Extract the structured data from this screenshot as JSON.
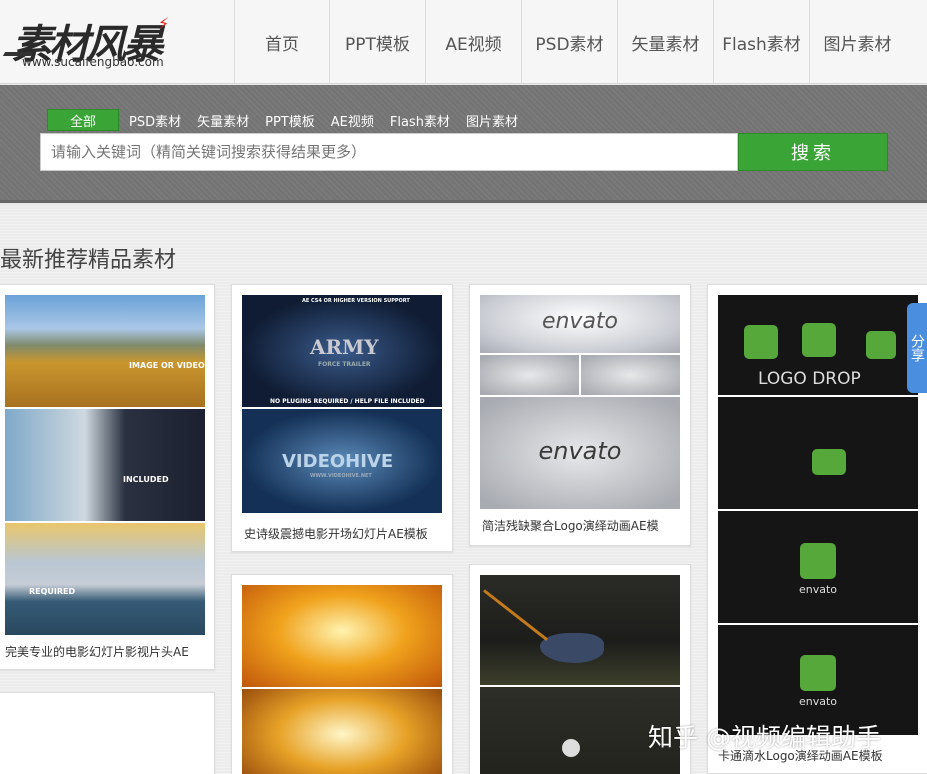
{
  "logo": {
    "text_cn": "素材风暴",
    "url": "www.sucaifengbao.com"
  },
  "nav": [
    {
      "label": "首页"
    },
    {
      "label": "PPT模板"
    },
    {
      "label": "AE视频"
    },
    {
      "label": "PSD素材"
    },
    {
      "label": "矢量素材"
    },
    {
      "label": "Flash素材"
    },
    {
      "label": "图片素材"
    }
  ],
  "search": {
    "tabs": [
      {
        "label": "全部"
      },
      {
        "label": "PSD素材"
      },
      {
        "label": "矢量素材"
      },
      {
        "label": "PPT模板"
      },
      {
        "label": "AE视频"
      },
      {
        "label": "Flash素材"
      },
      {
        "label": "图片素材"
      }
    ],
    "placeholder": "请输入关键词（精简关键词搜索获得结果更多）",
    "button": "搜索"
  },
  "section_title": "最新推荐精品素材",
  "cards": [
    {
      "caption": "完美专业的电影幻灯片影视片头AE",
      "overlay": [
        "IMAGE OR VIDEO",
        "INCLUDED",
        "REQUIRED"
      ]
    },
    {
      "caption": "史诗级震撼电影开场幻灯片AE模板",
      "overlay": [
        "AE CS4 OR HIGHER VERSION SUPPORT",
        "ARMY",
        "FORCE TRAILER",
        "NO PLUGINS REQUIRED / HELP FILE INCLUDED",
        "VIDEOHIVE",
        "WWW.VIDEOHIVE.NET"
      ]
    },
    {
      "caption": "简洁残缺聚合Logo演绎动画AE模",
      "overlay": [
        "envato",
        "envato"
      ]
    },
    {
      "caption": "卡通滴水Logo演绎动画AE模板",
      "overlay": [
        "LOGO DROP",
        "envato",
        "envato"
      ]
    }
  ],
  "share_label": "分享",
  "watermark": "知乎 @视频编辑助手"
}
